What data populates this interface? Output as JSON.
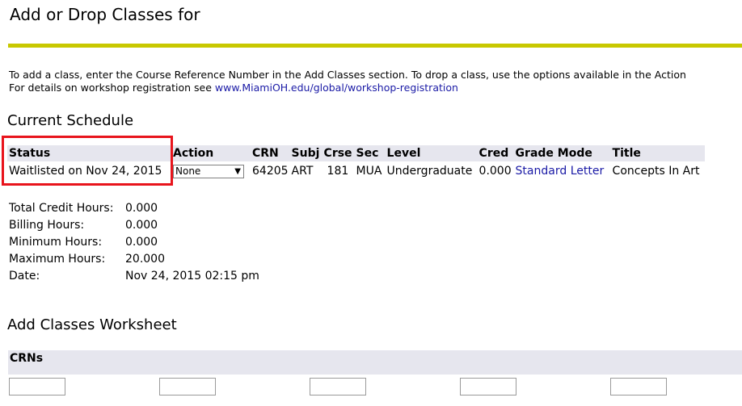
{
  "page": {
    "title": "Add or Drop Classes for",
    "instructions_line1": "To add a class, enter the Course Reference Number in the Add Classes section. To drop a class, use the options available in the Action",
    "instructions_line2_prefix": "For details on workshop registration see ",
    "workshop_link": "www.MiamiOH.edu/global/workshop-registration"
  },
  "schedule": {
    "heading": "Current Schedule",
    "columns": [
      "Status",
      "Action",
      "CRN",
      "Subj",
      "Crse",
      "Sec",
      "Level",
      "Cred",
      "Grade Mode",
      "Title"
    ],
    "rows": [
      {
        "status": "Waitlisted on Nov 24, 2015",
        "action": "None",
        "crn": "64205",
        "subj": "ART",
        "crse": "181",
        "sec": "MUA",
        "level": "Undergraduate",
        "cred": "0.000",
        "grade_mode": "Standard Letter",
        "title": "Concepts In Art"
      }
    ]
  },
  "hours": [
    {
      "label": "Total Credit Hours:",
      "value": "0.000"
    },
    {
      "label": "Billing Hours:",
      "value": "0.000"
    },
    {
      "label": "Minimum Hours:",
      "value": "0.000"
    },
    {
      "label": "Maximum Hours:",
      "value": "20.000"
    },
    {
      "label": "Date:",
      "value": "Nov 24, 2015 02:15 pm"
    }
  ],
  "worksheet": {
    "heading": "Add Classes Worksheet",
    "crns_label": "CRNs"
  },
  "colors": {
    "accent_rule": "#c8c800",
    "highlight_box": "#e8141c",
    "link": "#1a1aa6",
    "header_bg": "#e6e6ee"
  }
}
